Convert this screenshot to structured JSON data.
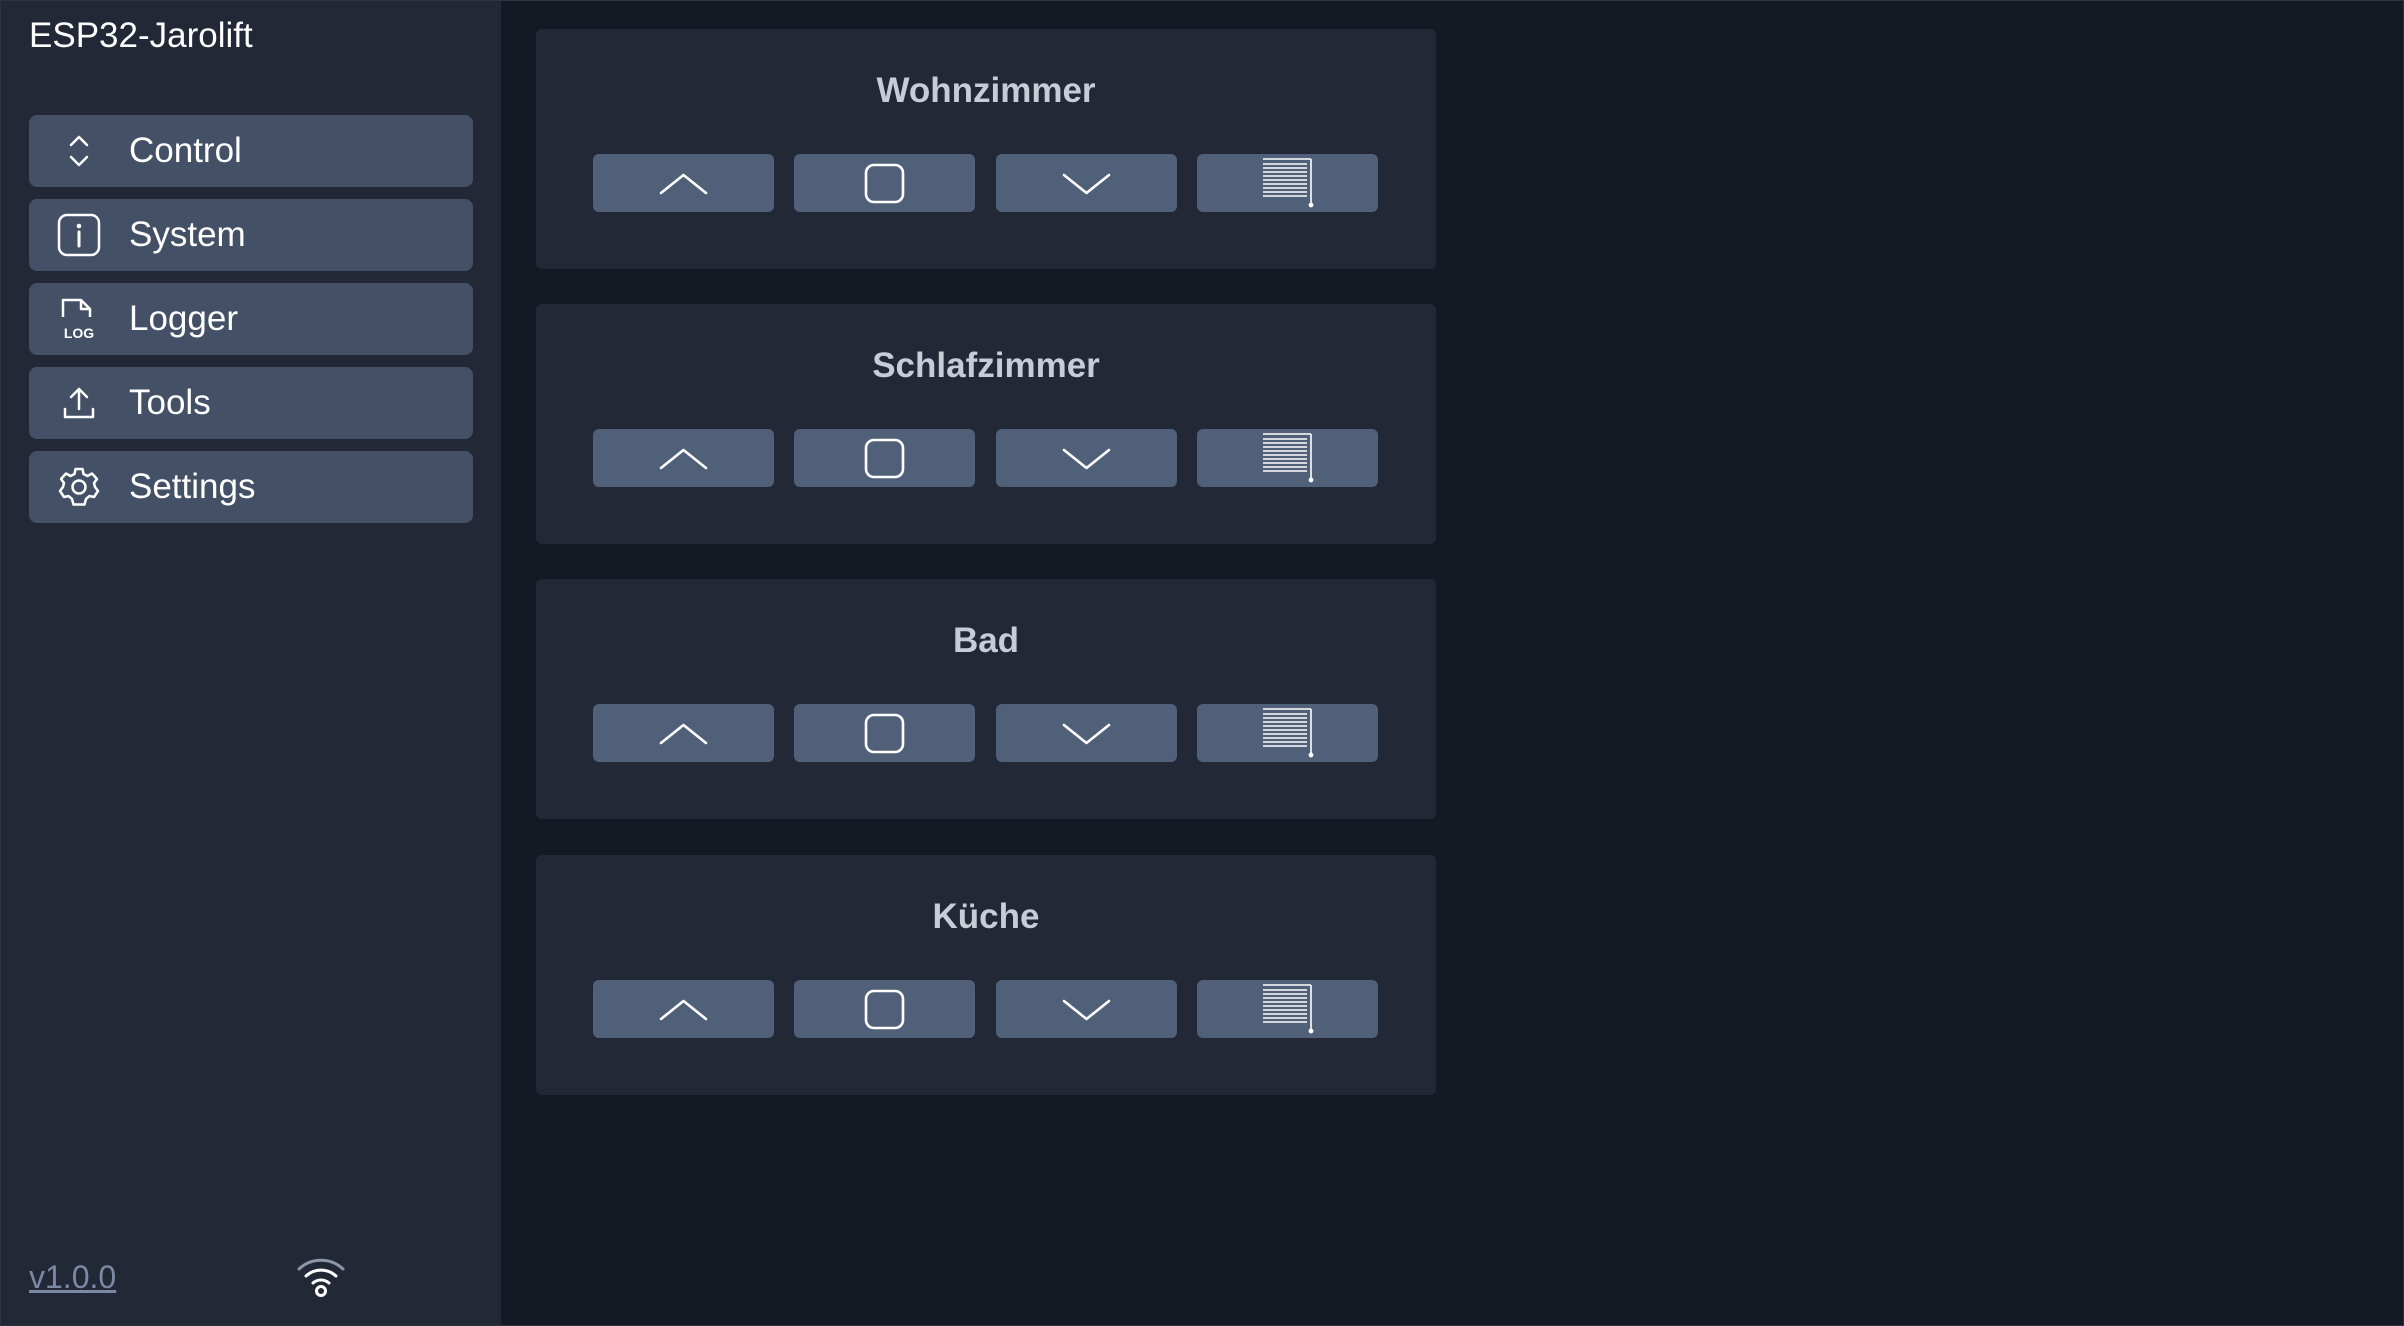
{
  "app": {
    "title": "ESP32-Jarolift",
    "version": "v1.0.0"
  },
  "sidebar": {
    "items": [
      {
        "label": "Control",
        "icon": "chevron-up-down-icon"
      },
      {
        "label": "System",
        "icon": "info-icon"
      },
      {
        "label": "Logger",
        "icon": "log-icon",
        "icon_text": "LOG"
      },
      {
        "label": "Tools",
        "icon": "upload-icon"
      },
      {
        "label": "Settings",
        "icon": "gear-icon"
      }
    ]
  },
  "status": {
    "wifi_icon": "wifi-icon"
  },
  "shutters": [
    {
      "name": "Wohnzimmer"
    },
    {
      "name": "Schlafzimmer"
    },
    {
      "name": "Bad"
    },
    {
      "name": "Küche"
    }
  ],
  "controls": [
    {
      "action": "up",
      "icon": "chevron-up-icon"
    },
    {
      "action": "stop",
      "icon": "stop-square-icon"
    },
    {
      "action": "down",
      "icon": "chevron-down-icon"
    },
    {
      "action": "shade",
      "icon": "blind-icon"
    }
  ],
  "colors": {
    "background": "#151923",
    "panel": "#222836",
    "nav_button": "#445066",
    "control_button": "#516079",
    "title_text": "#c8ccd6",
    "version_link": "#7c89a5"
  }
}
